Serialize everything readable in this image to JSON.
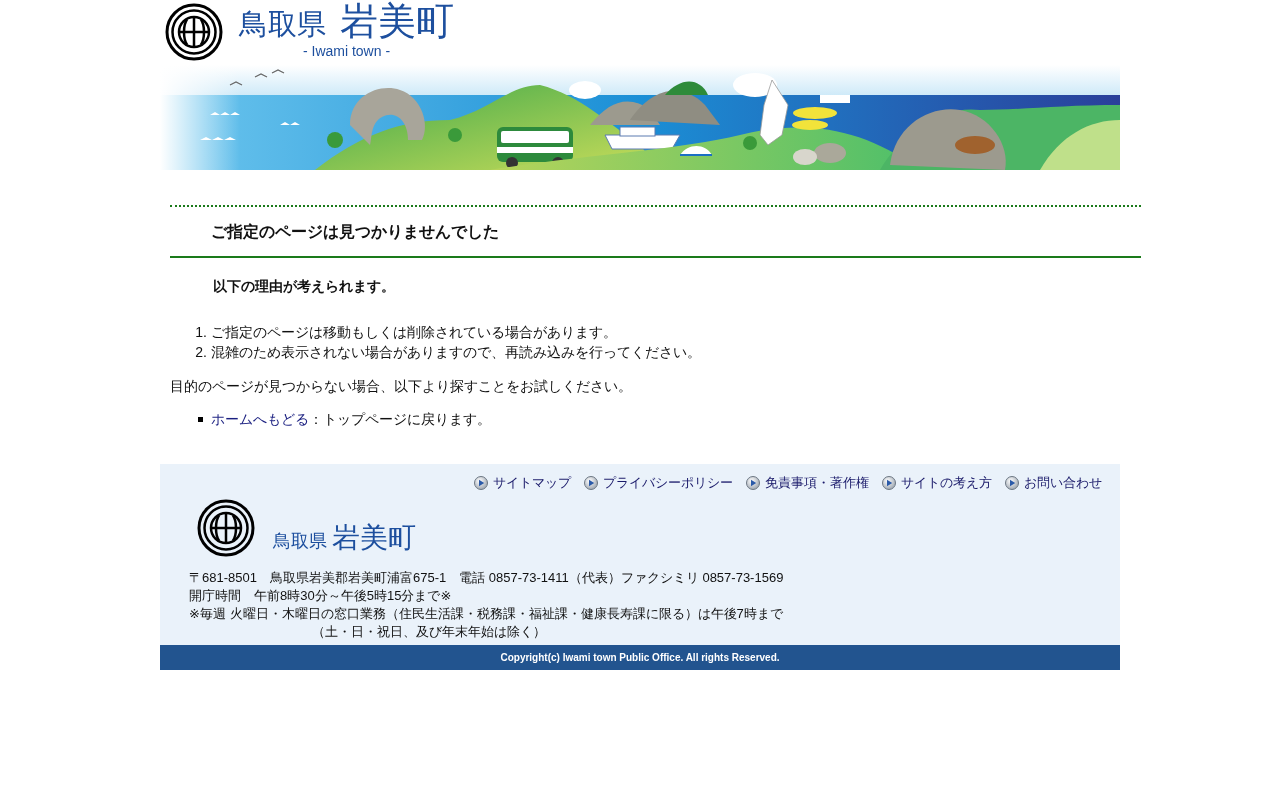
{
  "header": {
    "logo": {
      "prefecture": "鳥取県",
      "town": "岩美町",
      "subtitle": "- Iwami town -"
    }
  },
  "main": {
    "heading": "ご指定のページは見つかりませんでした",
    "subheading": "以下の理由が考えられます。",
    "reasons": [
      {
        "number": "1.",
        "text": "ご指定のページは移動もしくは削除されている場合があります。"
      },
      {
        "number": "2.",
        "text": "混雑のため表示されない場合がありますので、再読み込みを行ってください。"
      }
    ],
    "note": "目的のページが見つからない場合、以下より探すことをお試しください。",
    "links": [
      {
        "label": "ホームへもどる",
        "description": "：トップページに戻ります。"
      }
    ]
  },
  "footer": {
    "links": [
      "サイトマップ",
      "プライバシーポリシー",
      "免責事項・著作権",
      "サイトの考え方",
      "お問い合わせ"
    ],
    "logo": {
      "prefecture": "鳥取県",
      "town": "岩美町"
    },
    "address_lines": [
      {
        "kind": "line",
        "text": "〒681-8501　鳥取県岩美郡岩美町浦富675-1　電話 0857-73-1411（代表）ファクシミリ 0857-73-1569"
      },
      {
        "kind": "line",
        "text": "開庁時間　午前8時30分～午後5時15分まで※"
      },
      {
        "kind": "line",
        "text": "※毎週 火曜日・木曜日の窓口業務（住民生活課・税務課・福祉課・健康長寿課に限る）は午後7時まで"
      },
      {
        "kind": "continuation",
        "text": "（土・日・祝日、及び年末年始は除く）"
      }
    ],
    "copyright": "Copyright(c) Iwami town Public Office. All rights Reserved."
  }
}
